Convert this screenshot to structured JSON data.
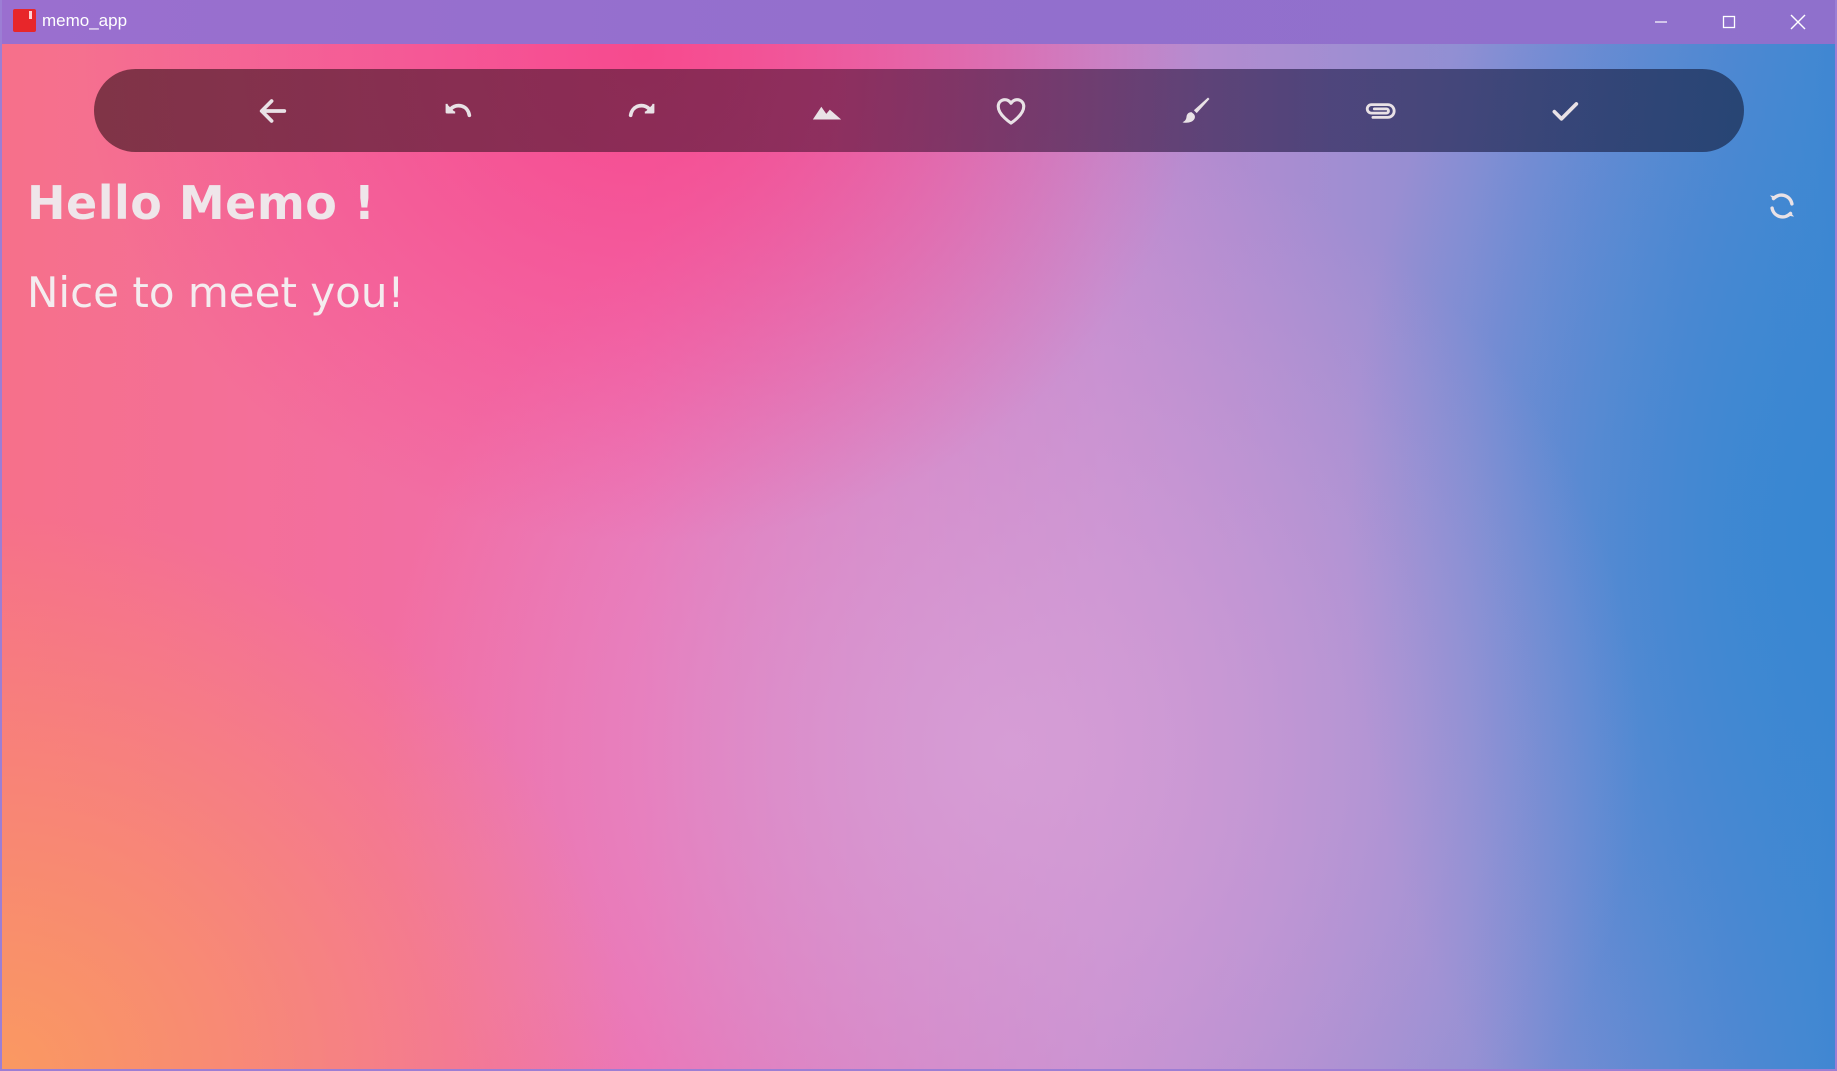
{
  "window": {
    "title": "memo_app",
    "icon": "app-logo-icon",
    "controls": [
      "minimize-icon",
      "maximize-icon",
      "close-icon"
    ]
  },
  "toolbar": {
    "items": [
      {
        "icon": "arrow-left-icon",
        "action": "back"
      },
      {
        "icon": "undo-icon",
        "action": "undo"
      },
      {
        "icon": "redo-icon",
        "action": "redo"
      },
      {
        "icon": "mountain-image-icon",
        "action": "image"
      },
      {
        "icon": "heart-icon",
        "action": "favorite"
      },
      {
        "icon": "brush-icon",
        "action": "paint"
      },
      {
        "icon": "paperclip-icon",
        "action": "attach"
      },
      {
        "icon": "check-icon",
        "action": "done"
      }
    ]
  },
  "memo": {
    "title": "Hello Memo !",
    "body": "Nice to meet you!"
  },
  "refresh_icon": "refresh-icon",
  "colors": {
    "text": "#efe6ea",
    "icon": "#e9e2e6",
    "titlebar": "#9370cd",
    "app_icon": "#e8262a"
  }
}
